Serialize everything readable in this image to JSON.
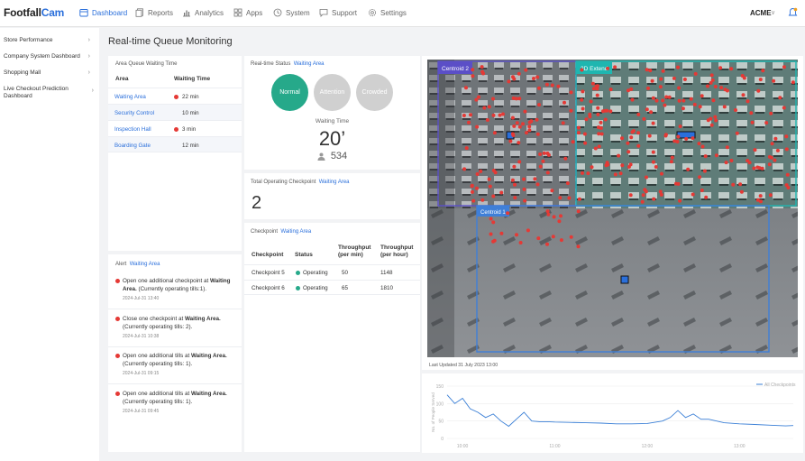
{
  "brand": {
    "name_a": "Footfall",
    "name_b": "Cam"
  },
  "nav": {
    "items": [
      {
        "label": "Dashboard",
        "icon": "calendar-icon",
        "active": true
      },
      {
        "label": "Reports",
        "icon": "copy-icon",
        "active": false
      },
      {
        "label": "Analytics",
        "icon": "bar-chart-icon",
        "active": false
      },
      {
        "label": "Apps",
        "icon": "grid-icon",
        "active": false
      },
      {
        "label": "System",
        "icon": "clock-icon",
        "active": false
      },
      {
        "label": "Support",
        "icon": "chat-icon",
        "active": false
      },
      {
        "label": "Settings",
        "icon": "gear-icon",
        "active": false
      }
    ],
    "account": "ACME",
    "accent": "#2a6fdb"
  },
  "sidebar": {
    "items": [
      {
        "label": "Store Performance"
      },
      {
        "label": "Company System Dashboard"
      },
      {
        "label": "Shopping Mall"
      },
      {
        "label": "Live Checkout Prediction Dashboard"
      }
    ]
  },
  "page": {
    "title": "Real-time Queue Monitoring"
  },
  "queue": {
    "title": "Area Queue Waiting Time",
    "col_area": "Area",
    "col_time": "Waiting Time",
    "rows": [
      {
        "area": "Waiting Area",
        "time": "22 min",
        "alert": true
      },
      {
        "area": "Security Control",
        "time": "10 min",
        "alert": false
      },
      {
        "area": "Inspection Hall",
        "time": "3 min",
        "alert": true
      },
      {
        "area": "Boarding Gate",
        "time": "12 min",
        "alert": false
      }
    ]
  },
  "alerts": {
    "title": "Alert",
    "area": "Waiting Area",
    "items": [
      {
        "pre": "Open one additional checkpoint at ",
        "bold": "Waiting Area.",
        "post": " (Currently operating tills:1).",
        "time": "2024-Jul-31 13:40"
      },
      {
        "pre": "Close one checkpoint at ",
        "bold": "Waiting Area.",
        "post": " (Currently operating tills: 2).",
        "time": "2024-Jul-31 10:38"
      },
      {
        "pre": "Open one additional tills at ",
        "bold": "Waiting Area.",
        "post": " (Currently operating tills: 1).",
        "time": "2024-Jul-31 09:15"
      },
      {
        "pre": "Open one additional tills at ",
        "bold": "Waiting Area.",
        "post": " (Currently operating tills: 1).",
        "time": "2024-Jul-31 09:45"
      }
    ]
  },
  "status": {
    "title": "Real-time Status",
    "area": "Waiting Area",
    "states": [
      "Normal",
      "Attention",
      "Crowded"
    ],
    "active_state": "Normal",
    "waiting_label": "Waiting Time",
    "waiting_value": "20’",
    "people_count": "534",
    "colors": {
      "normal": "#26a98a",
      "inactive": "#d0d0d0"
    }
  },
  "operating": {
    "title": "Total Operating Checkpoint",
    "area": "Waiting Area",
    "value": "2"
  },
  "checkpoints": {
    "title": "Checkpoint",
    "area": "Waiting Area",
    "headers": [
      "Checkpoint",
      "Status",
      "Throughput (per min)",
      "Throughput (per hour)"
    ],
    "rows": [
      {
        "name": "Checkpoint 5",
        "status": "Operating",
        "per_min": "50",
        "per_hour": "1148"
      },
      {
        "name": "Checkpoint 6",
        "status": "Operating",
        "per_min": "65",
        "per_hour": "1810"
      }
    ]
  },
  "video": {
    "zones": [
      {
        "label": "Centroid 2",
        "color": "#5b4fc7"
      },
      {
        "label": "3D Extend",
        "color": "#1fb6b0"
      },
      {
        "label": "Centroid 1",
        "color": "#3f7fd8"
      }
    ],
    "last_updated": "Last Updated 31 July 2023 13:00"
  },
  "chart_data": {
    "type": "line",
    "title": "",
    "ylabel": "No. of People Served",
    "xlabel": "",
    "legend": "top-right",
    "ylim": [
      0,
      150
    ],
    "yticks": [
      0,
      50,
      100,
      150
    ],
    "xticks": [
      "10:00",
      "11:00",
      "12:00",
      "13:00"
    ],
    "x_range": [
      "09:50",
      "13:35"
    ],
    "series": [
      {
        "name": "All Checkpoints",
        "color": "#3a7fd6",
        "x": [
          "09:50",
          "09:55",
          "10:00",
          "10:05",
          "10:10",
          "10:15",
          "10:20",
          "10:25",
          "10:30",
          "10:35",
          "10:40",
          "10:45",
          "10:50",
          "10:55",
          "11:00",
          "11:10",
          "11:20",
          "11:30",
          "11:40",
          "11:50",
          "12:00",
          "12:10",
          "12:15",
          "12:20",
          "12:25",
          "12:30",
          "12:35",
          "12:40",
          "12:50",
          "13:00",
          "13:10",
          "13:20",
          "13:30",
          "13:35"
        ],
        "values": [
          125,
          100,
          115,
          85,
          75,
          60,
          70,
          50,
          35,
          55,
          75,
          50,
          48,
          48,
          47,
          46,
          45,
          44,
          42,
          42,
          43,
          50,
          60,
          80,
          60,
          70,
          55,
          55,
          45,
          42,
          40,
          38,
          36,
          37
        ]
      }
    ]
  }
}
